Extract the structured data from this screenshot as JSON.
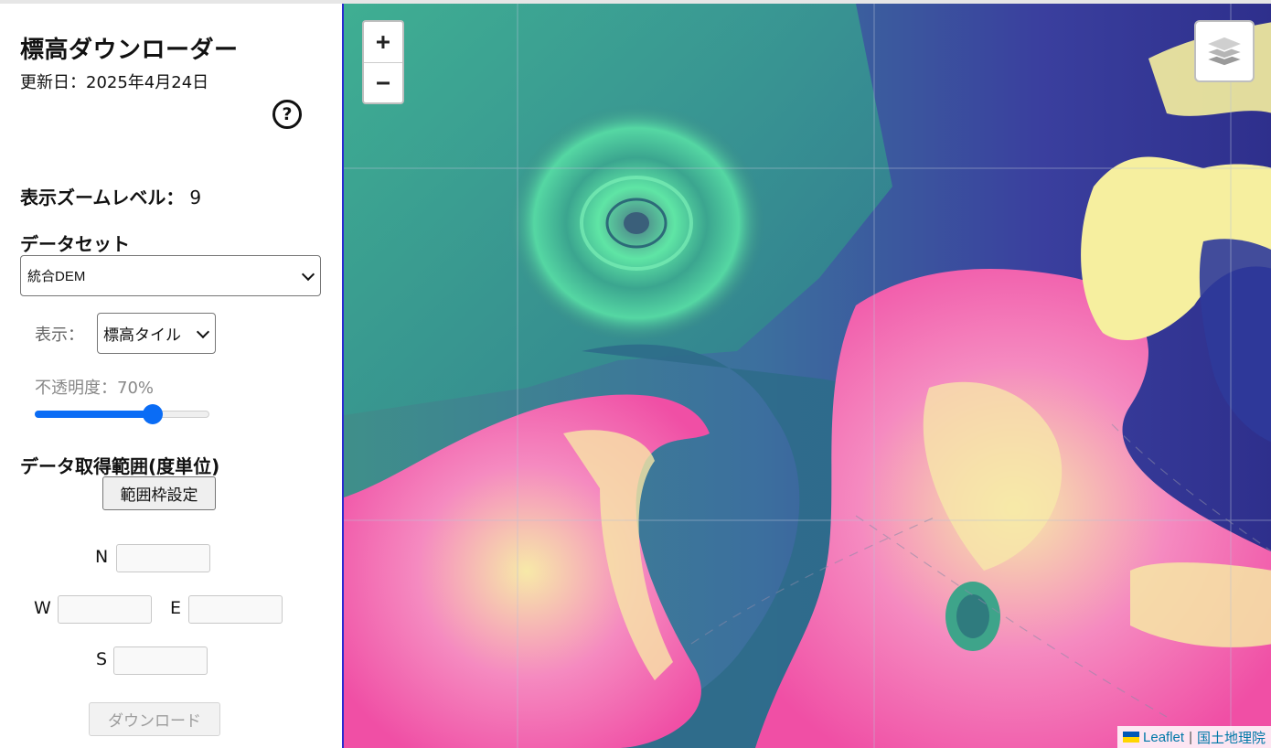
{
  "sidebar": {
    "title": "標高ダウンローダー",
    "update_date": "更新日：2025年4月24日",
    "help_icon_text": "?",
    "zoom_label": "表示ズームレベル：",
    "zoom_value": "9",
    "dataset_label": "データセット",
    "dataset_selected": "統合DEM",
    "display_label": "表示：",
    "display_selected": "標高タイル",
    "opacity_label": "不透明度：",
    "opacity_value": "70%",
    "opacity_fraction": 0.7,
    "range_label": "データ取得範囲(度単位)",
    "bbox_button": "範囲枠設定",
    "coord_labels": {
      "n": "N",
      "w": "W",
      "e": "E",
      "s": "S"
    },
    "coord_values": {
      "n": "",
      "w": "",
      "e": "",
      "s": ""
    },
    "download_button": "ダウンロード"
  },
  "map": {
    "zoom_in": "+",
    "zoom_out": "−",
    "attribution_leaflet": "Leaflet",
    "attribution_separator": "|",
    "attribution_gsi": "国土地理院"
  }
}
